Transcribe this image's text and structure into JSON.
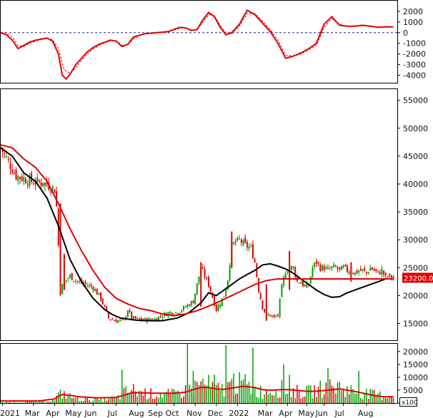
{
  "chart_data": [
    {
      "type": "line",
      "panel": "oscillator",
      "ylim": [
        -4700,
        3000
      ],
      "yticks": [
        "2000",
        "1000",
        "0",
        "-1000",
        "-2000",
        "-3000",
        "-4000"
      ],
      "ytick_values": [
        2000,
        1000,
        0,
        -1000,
        -2000,
        -3000,
        -4000
      ],
      "reference_line": 0,
      "series": [
        {
          "role": "oscillator",
          "color": "#e00000",
          "x": [
            0,
            3,
            6,
            9,
            12,
            15,
            18,
            21,
            24,
            27,
            30,
            32,
            34,
            36,
            39,
            42,
            45,
            48,
            51,
            54,
            57,
            60,
            63,
            66,
            69,
            71,
            73,
            75,
            78,
            81,
            84,
            87,
            90,
            93,
            96,
            99,
            102,
            105,
            108,
            111,
            114,
            117,
            120,
            124,
            128,
            132,
            136,
            140,
            144,
            148,
            152,
            156,
            160,
            164,
            168,
            172,
            176,
            180,
            184,
            188,
            192,
            196,
            200,
            204
          ],
          "values": [
            0,
            -200,
            -700,
            -1500,
            -1200,
            -900,
            -700,
            -600,
            -500,
            -800,
            -2000,
            -4000,
            -4350,
            -3900,
            -3000,
            -2400,
            -1800,
            -1400,
            -1100,
            -900,
            -700,
            -800,
            -1300,
            -1100,
            -400,
            -300,
            -200,
            -100,
            -50,
            0,
            50,
            100,
            300,
            500,
            450,
            200,
            300,
            1200,
            1900,
            1500,
            500,
            -200,
            0,
            800,
            2100,
            1700,
            900,
            100,
            -1000,
            -2400,
            -2200,
            -1900,
            -1500,
            -1000,
            800,
            1500,
            700,
            600,
            600,
            700,
            600,
            500,
            550,
            550
          ]
        },
        {
          "role": "signal",
          "color": "#e00000",
          "dashed": true,
          "x": [
            0,
            3,
            6,
            9,
            12,
            15,
            18,
            21,
            24,
            27,
            30,
            33,
            36,
            39,
            42,
            45,
            48,
            51,
            54,
            57,
            60,
            63,
            66,
            69,
            72,
            75,
            78,
            81,
            84,
            87,
            90,
            93,
            96,
            99,
            102,
            105,
            108,
            111,
            114,
            117,
            120,
            124,
            128,
            132,
            136,
            140,
            144,
            148,
            152,
            156,
            160,
            164,
            168,
            172,
            176,
            180,
            184,
            188,
            192,
            196,
            200,
            204
          ],
          "values": [
            0,
            0,
            -400,
            -1200,
            -1300,
            -1000,
            -800,
            -650,
            -550,
            -650,
            -1500,
            -3500,
            -3800,
            -3300,
            -2600,
            -2000,
            -1550,
            -1200,
            -950,
            -750,
            -750,
            -1200,
            -1150,
            -600,
            -250,
            -120,
            -60,
            -20,
            30,
            80,
            250,
            420,
            450,
            250,
            250,
            1000,
            1700,
            1600,
            700,
            0,
            -100,
            600,
            1800,
            1800,
            1100,
            300,
            -700,
            -2100,
            -2200,
            -2000,
            -1600,
            -1200,
            500,
            1300,
            800,
            600,
            600,
            650,
            600,
            550,
            500,
            500
          ]
        }
      ]
    },
    {
      "type": "candlestick",
      "panel": "price",
      "ylim": [
        12000,
        57000
      ],
      "yticks": [
        "55000",
        "50000",
        "45000",
        "40000",
        "35000",
        "30000",
        "25000",
        "20000",
        "15000"
      ],
      "ytick_values": [
        55000,
        50000,
        45000,
        40000,
        35000,
        30000,
        25000,
        20000,
        15000
      ],
      "last_price_label": "23200.00",
      "colors": {
        "up": "#00a000",
        "down": "#e00000",
        "ma_fast": "#000000",
        "ma_slow": "#e00000",
        "tag": "#e00000"
      },
      "price_path": {
        "x": [
          0,
          4,
          8,
          12,
          16,
          20,
          24,
          28,
          29,
          30,
          31,
          33,
          36,
          40,
          44,
          48,
          52,
          56,
          60,
          64,
          66,
          68,
          72,
          76,
          80,
          84,
          88,
          92,
          96,
          100,
          104,
          108,
          112,
          116,
          118,
          120,
          124,
          127,
          130,
          132,
          134,
          136,
          138,
          140,
          142,
          144,
          146,
          148,
          150,
          152,
          154,
          156,
          158,
          160,
          162,
          164,
          166,
          168,
          170,
          172,
          174,
          176,
          178,
          180,
          182,
          184,
          186,
          188,
          190,
          192,
          194,
          196,
          198,
          200,
          202,
          204
        ],
        "close": [
          46500,
          44000,
          41500,
          41000,
          40500,
          40300,
          40000,
          39000,
          36000,
          29000,
          21000,
          22500,
          23500,
          22500,
          22000,
          21500,
          19500,
          16000,
          15500,
          15500,
          17500,
          16000,
          15700,
          15700,
          15800,
          16500,
          17000,
          17000,
          18000,
          19000,
          25000,
          22000,
          17500,
          20000,
          23000,
          29000,
          30000,
          29000,
          28500,
          26000,
          21000,
          18000,
          16500,
          16500,
          16000,
          16500,
          21500,
          24500,
          25000,
          25000,
          22500,
          22500,
          21500,
          22000,
          25000,
          26000,
          25000,
          25000,
          24500,
          25000,
          25000,
          24500,
          25000,
          24500,
          24500,
          24000,
          24500,
          24500,
          24000,
          25000,
          24500,
          24000,
          24500,
          23200,
          23500,
          23200
        ]
      },
      "series": [
        {
          "name": "",
          "role": "ma_fast",
          "x": [
            0,
            6,
            12,
            18,
            24,
            30,
            36,
            42,
            48,
            54,
            58,
            62,
            66,
            70,
            76,
            84,
            92,
            98,
            104,
            108,
            112,
            116,
            120,
            124,
            128,
            132,
            136,
            140,
            144,
            148,
            152,
            156,
            160,
            164,
            168,
            172,
            176,
            180,
            184,
            188,
            192,
            196,
            200,
            204
          ],
          "values": [
            46500,
            45000,
            42000,
            40500,
            37500,
            32500,
            26500,
            22500,
            19500,
            17500,
            16600,
            16000,
            15800,
            15600,
            15500,
            15500,
            16000,
            17000,
            18700,
            20500,
            20000,
            21000,
            22000,
            23000,
            23800,
            24500,
            25500,
            25700,
            25300,
            24800,
            24000,
            23000,
            22000,
            21000,
            20200,
            19700,
            19800,
            20500,
            21000,
            21500,
            22000,
            22500,
            23000,
            23000
          ]
        },
        {
          "name": "",
          "role": "ma_slow",
          "x": [
            0,
            6,
            12,
            18,
            24,
            30,
            36,
            42,
            48,
            54,
            60,
            66,
            72,
            78,
            84,
            90,
            96,
            102,
            108,
            114,
            120,
            126,
            132,
            138,
            144,
            150,
            156,
            162,
            168,
            174,
            180,
            186,
            192,
            198,
            204
          ],
          "values": [
            47000,
            46500,
            44500,
            43000,
            40500,
            36500,
            32000,
            28000,
            24500,
            21500,
            19500,
            18500,
            17700,
            17300,
            16700,
            16400,
            16700,
            17300,
            18100,
            19000,
            20000,
            21000,
            22000,
            22700,
            23000,
            23000,
            23000,
            23000,
            23000,
            23000,
            23000,
            23000,
            23000,
            23000,
            23000
          ]
        }
      ],
      "spikes": [
        {
          "x": 31,
          "high": 36500,
          "low": 20000
        },
        {
          "x": 33,
          "high": 27500,
          "low": 21000
        },
        {
          "x": 104,
          "high": 26000,
          "low": 18000
        },
        {
          "x": 120,
          "high": 31500,
          "low": 25000
        },
        {
          "x": 138,
          "high": 22000,
          "low": 15500
        },
        {
          "x": 150,
          "high": 28000,
          "low": 21000
        },
        {
          "x": 182,
          "high": 26000,
          "low": 22500
        }
      ]
    },
    {
      "type": "bar",
      "panel": "volume",
      "ylim": [
        0,
        23000
      ],
      "yticks": [
        "20000",
        "15000",
        "10000",
        "5000",
        "0"
      ],
      "ytick_values": [
        20000,
        15000,
        10000,
        5000,
        0
      ],
      "unit_label": "x100",
      "colors": {
        "up": "#00a000",
        "down": "#e00000",
        "ma": "#e00000"
      },
      "volume_profile": {
        "x": [
          0,
          20,
          28,
          30,
          32,
          36,
          40,
          50,
          60,
          64,
          68,
          72,
          80,
          90,
          96,
          100,
          104,
          108,
          112,
          116,
          120,
          126,
          132,
          136,
          140,
          146,
          150,
          156,
          160,
          164,
          170,
          176,
          180,
          186,
          192,
          198,
          204
        ],
        "values": [
          300,
          500,
          1500,
          3500,
          4500,
          3000,
          2000,
          1500,
          2000,
          4500,
          6000,
          5000,
          4000,
          4000,
          5500,
          7000,
          9000,
          8000,
          6000,
          6500,
          8000,
          9000,
          6000,
          5000,
          6000,
          6500,
          5500,
          5000,
          5000,
          6000,
          7000,
          7500,
          6000,
          5000,
          4000,
          3500,
          3000
        ]
      },
      "spikes": [
        {
          "x": 63,
          "value": 13000
        },
        {
          "x": 97,
          "value": 23000
        },
        {
          "x": 100,
          "value": 12500
        },
        {
          "x": 111,
          "value": 11000
        },
        {
          "x": 117,
          "value": 22500
        },
        {
          "x": 121,
          "value": 11500
        },
        {
          "x": 131,
          "value": 21500
        },
        {
          "x": 147,
          "value": 15000
        },
        {
          "x": 150,
          "value": 11000
        },
        {
          "x": 170,
          "value": 13500
        },
        {
          "x": 186,
          "value": 12500
        }
      ],
      "ma_values": [
        800,
        800,
        1600,
        2600,
        3300,
        3000,
        2500,
        2000,
        2200,
        3000,
        4000,
        4000,
        3800,
        3800,
        4200,
        5200,
        6000,
        6000,
        5500,
        5300,
        5800,
        6500,
        6000,
        5200,
        5000,
        5200,
        5200,
        4800,
        4500,
        4600,
        5000,
        5500,
        5000,
        4200,
        3200,
        2500,
        2400
      ]
    }
  ],
  "x_axis": {
    "labels": [
      "2021",
      "Mar",
      "Apr",
      "May",
      "Jun",
      "Jul",
      "Aug",
      "Sep",
      "Oct",
      "Nov",
      "Dec",
      "2022",
      "Mar",
      "Apr",
      "May",
      "Jun",
      "Jul",
      "Aug"
    ],
    "positions": [
      1,
      17,
      28,
      38,
      48,
      60,
      71,
      81,
      90,
      101,
      112,
      123,
      138,
      149,
      159,
      168,
      178,
      190
    ]
  }
}
